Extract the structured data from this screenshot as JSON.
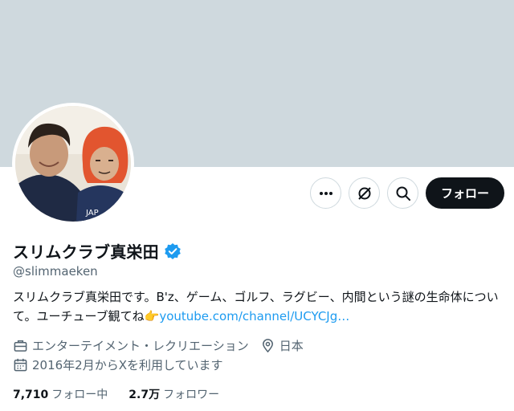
{
  "profile": {
    "display_name": "スリムクラブ真栄田",
    "handle": "@slimmaeken",
    "bio_text": "スリムクラブ真栄田です。B'z、ゲーム、ゴルフ、ラグビー、内間という謎の生命体について。ユーチューブ観てね👉",
    "bio_link": "youtube.com/channel/UCYCJg…",
    "category": "エンターテイメント・レクリエーション",
    "location": "日本",
    "joined": "2016年2月からXを利用しています",
    "following_count": "7,710",
    "following_label": "フォロー中",
    "followers_count": "2.7万",
    "followers_label": "フォロワー"
  },
  "actions": {
    "follow_label": "フォロー",
    "more_icon": "more-icon",
    "grok_icon": "grok-icon",
    "search_icon": "search-icon"
  },
  "colors": {
    "banner": "#cfd9de",
    "link": "#1d9bf0",
    "verified": "#1d9bf0",
    "follow_button": "#0f1419",
    "secondary_text": "#536471"
  }
}
